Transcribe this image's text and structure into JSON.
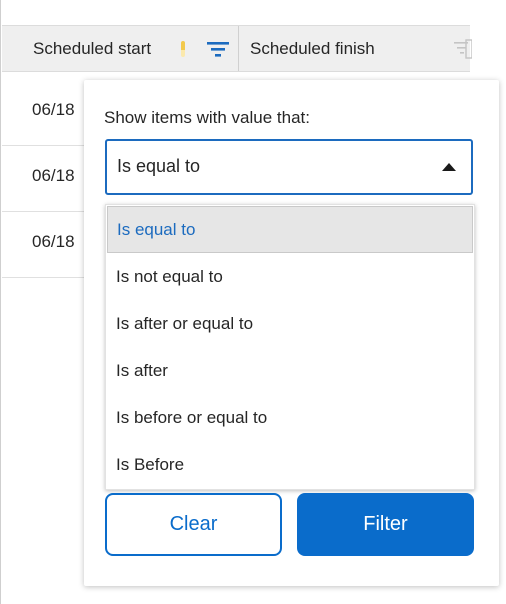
{
  "header": {
    "col_start_label": "Scheduled start",
    "col_finish_label": "Scheduled finish"
  },
  "rows": [
    {
      "start": "06/18"
    },
    {
      "start": "06/18"
    },
    {
      "start": "06/18"
    }
  ],
  "filter_popup": {
    "title": "Show items with value that:",
    "selected_value": "Is equal to",
    "options": [
      "Is equal to",
      "Is not equal to",
      "Is after or equal to",
      "Is after",
      "Is before or equal to",
      "Is Before"
    ],
    "clear_label": "Clear",
    "filter_label": "Filter"
  },
  "colors": {
    "accent": "#0a6ccb",
    "selected_text": "#1c6bbf",
    "sort_indicator": "#f2c94c",
    "header_bg": "#efefef"
  },
  "icons": {
    "sort": "sort-ascending-icon",
    "filter_active": "filter-icon",
    "filter_inactive": "filter-icon",
    "dropdown_caret": "caret-up-icon"
  }
}
